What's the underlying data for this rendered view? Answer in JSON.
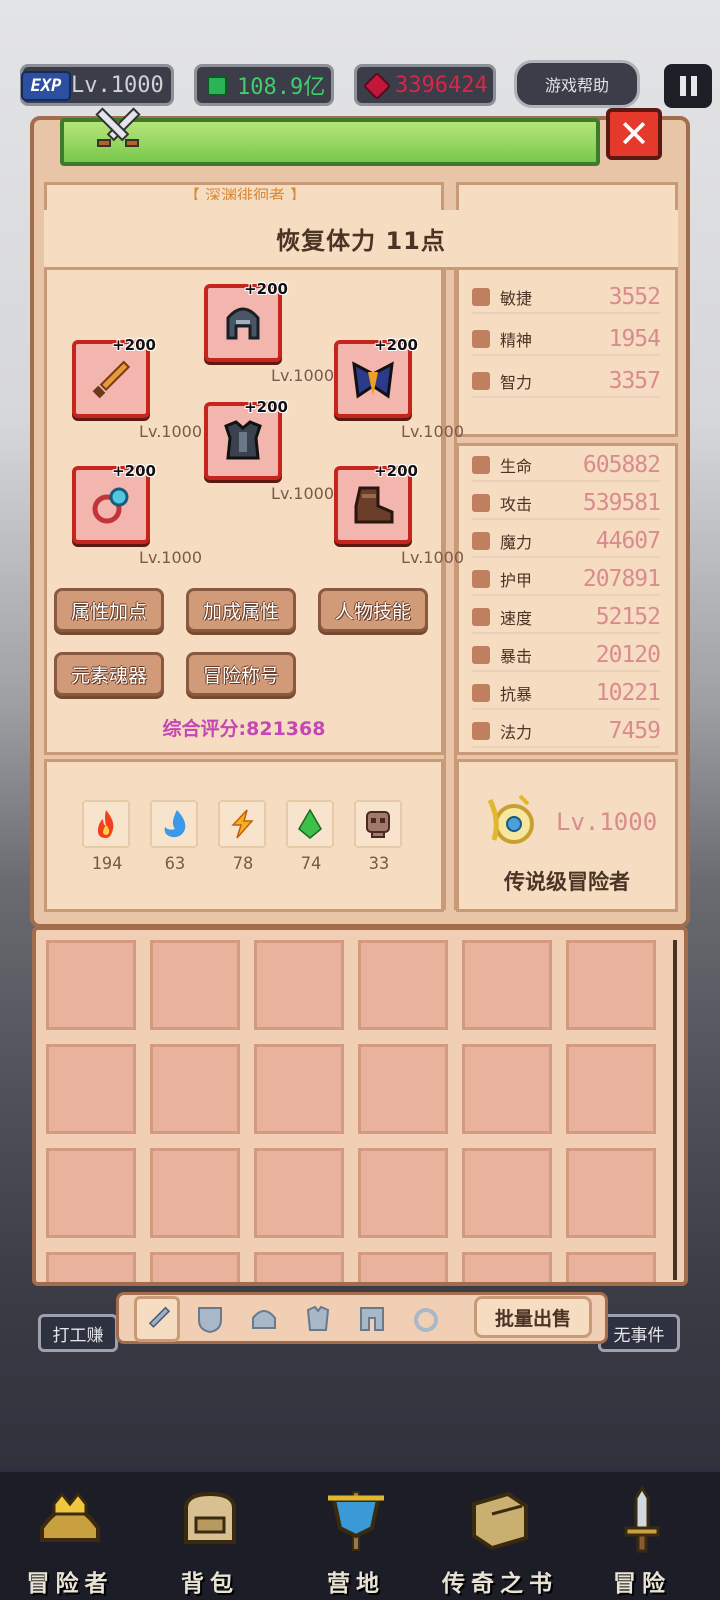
{
  "top_bar": {
    "exp_badge": "EXP",
    "level": "Lv.1000",
    "gold": "108.9亿",
    "gems": "3396424",
    "help_label": "游戏帮助"
  },
  "panel": {
    "sub_title": "【 深渊徘徊者 】",
    "header": "恢复体力 11点",
    "equipment": [
      {
        "slot": "weapon",
        "icon": "sword-icon",
        "bonus": "+200",
        "level": "Lv.1000"
      },
      {
        "slot": "helmet",
        "icon": "helmet-icon",
        "bonus": "+200",
        "level": "Lv.1000"
      },
      {
        "slot": "shoulder",
        "icon": "pauldron-icon",
        "bonus": "+200",
        "level": "Lv.1000"
      },
      {
        "slot": "armor",
        "icon": "armor-icon",
        "bonus": "+200",
        "level": "Lv.1000"
      },
      {
        "slot": "ring",
        "icon": "ring-icon",
        "bonus": "+200",
        "level": "Lv.1000"
      },
      {
        "slot": "boots",
        "icon": "boots-icon",
        "bonus": "+200",
        "level": "Lv.1000"
      }
    ],
    "buttons": [
      "属性加点",
      "加成属性",
      "人物技能",
      "元素魂器",
      "冒险称号"
    ],
    "score": "综合评分:821368",
    "elements": [
      {
        "icon": "fire-icon",
        "value": "194"
      },
      {
        "icon": "water-icon",
        "value": "63"
      },
      {
        "icon": "lightning-icon",
        "value": "78"
      },
      {
        "icon": "wind-icon",
        "value": "74"
      },
      {
        "icon": "skull-icon",
        "value": "33"
      }
    ],
    "base_stats": [
      {
        "name": "敏捷",
        "value": "3552"
      },
      {
        "name": "精神",
        "value": "1954"
      },
      {
        "name": "智力",
        "value": "3357"
      }
    ],
    "combat_stats": [
      {
        "name": "生命",
        "value": "605882"
      },
      {
        "name": "攻击",
        "value": "539581"
      },
      {
        "name": "魔力",
        "value": "44607"
      },
      {
        "name": "护甲",
        "value": "207891"
      },
      {
        "name": "速度",
        "value": "52152"
      },
      {
        "name": "暴击",
        "value": "20120"
      },
      {
        "name": "抗暴",
        "value": "10221"
      },
      {
        "name": "法力",
        "value": "7459"
      }
    ],
    "rank_level": "Lv.1000",
    "rank_title": "传说级冒险者"
  },
  "inventory": {
    "tabs": [
      "sword-icon",
      "shield-icon",
      "helmet-icon",
      "armor-icon",
      "pants-icon",
      "ring-icon"
    ],
    "bulk_sell": "批量出售"
  },
  "background": {
    "left_button": "打工赚",
    "right_button": "无事件"
  },
  "bottom_nav": [
    {
      "icon": "adventurer-icon",
      "label": "冒险者"
    },
    {
      "icon": "backpack-icon",
      "label": "背包"
    },
    {
      "icon": "camp-icon",
      "label": "营地"
    },
    {
      "icon": "legend-book-icon",
      "label": "传奇之书"
    },
    {
      "icon": "adventure-icon",
      "label": "冒险"
    }
  ],
  "colors": {
    "panel_bg": "#e9c5a8",
    "inner_bg": "#f6dcc0",
    "stat_value": "#d98c8f",
    "score": "#c447b5",
    "close_red": "#e5392b",
    "title_green": "#79c84b"
  }
}
